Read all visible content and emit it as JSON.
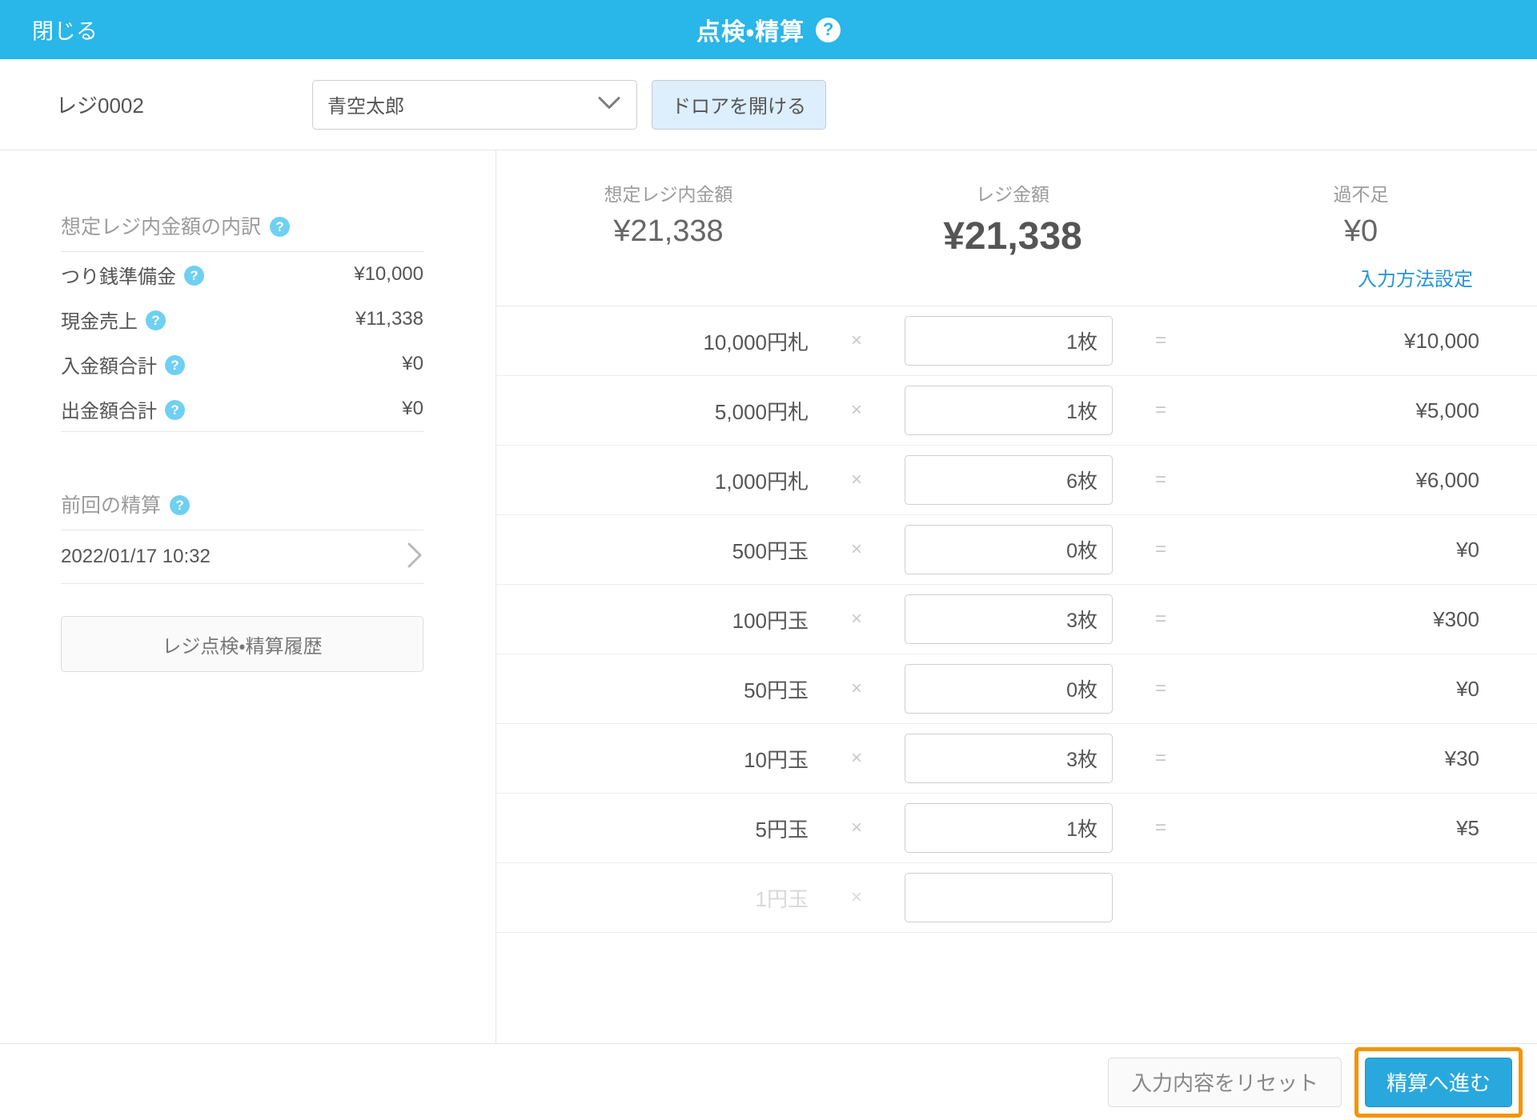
{
  "titlebar": {
    "close_label": "閉じる",
    "title": "点検・精算",
    "help_icon": "help-circle-icon",
    "help_glyph": "?",
    "background_color": "#29b6e8"
  },
  "subheader": {
    "register_name": "レジ0002",
    "staff_select": {
      "value": "青空太郎",
      "chevron_icon": "chevron-down-icon"
    },
    "open_drawer_label": "ドロアを開ける"
  },
  "sidebar": {
    "breakdown": {
      "title": "想定レジ内金額の内訳",
      "help_glyph": "?",
      "rows": [
        {
          "label": "つり銭準備金",
          "help": "?",
          "value": "¥10,000"
        },
        {
          "label": "現金売上",
          "help": "?",
          "value": "¥11,338"
        },
        {
          "label": "入金額合計",
          "help": "?",
          "value": "¥0"
        },
        {
          "label": "出金額合計",
          "help": "?",
          "value": "¥0"
        }
      ]
    },
    "last_settlement": {
      "title": "前回の精算",
      "help_glyph": "?",
      "datetime": "2022/01/17 10:32",
      "chevron_icon": "chevron-right-icon",
      "chevron_glyph": "›"
    },
    "history_button_label": "レジ点検・精算履歴"
  },
  "main": {
    "totals": [
      {
        "label": "想定レジ内金額",
        "value": "¥21,338",
        "emphasis": false
      },
      {
        "label": "レジ金額",
        "value": "¥21,338",
        "emphasis": true
      },
      {
        "label": "過不足",
        "value": "¥0",
        "emphasis": false
      }
    ],
    "input_method_link": "入力方法設定",
    "row_ops": {
      "multiply": "×",
      "equals": "="
    },
    "denominations": [
      {
        "name": "10,000円札",
        "qty": "1枚",
        "total": "¥10,000",
        "faded": false
      },
      {
        "name": "5,000円札",
        "qty": "1枚",
        "total": "¥5,000",
        "faded": false
      },
      {
        "name": "1,000円札",
        "qty": "6枚",
        "total": "¥6,000",
        "faded": false
      },
      {
        "name": "500円玉",
        "qty": "0枚",
        "total": "¥0",
        "faded": false
      },
      {
        "name": "100円玉",
        "qty": "3枚",
        "total": "¥300",
        "faded": false
      },
      {
        "name": "50円玉",
        "qty": "0枚",
        "total": "¥0",
        "faded": false
      },
      {
        "name": "10円玉",
        "qty": "3枚",
        "total": "¥30",
        "faded": false
      },
      {
        "name": "5円玉",
        "qty": "1枚",
        "total": "¥5",
        "faded": false
      },
      {
        "name": "1円玉",
        "qty": "",
        "total": "",
        "faded": true
      }
    ]
  },
  "bottombar": {
    "reset_label": "入力内容をリセット",
    "proceed_label": "精算へ進む",
    "highlight_color": "#f59300",
    "proceed_color": "#29a8dd"
  }
}
